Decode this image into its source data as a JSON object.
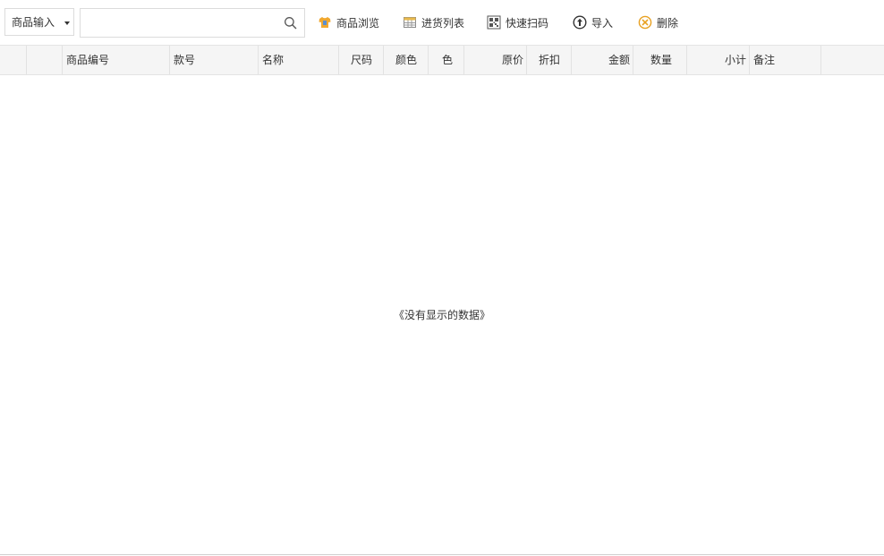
{
  "toolbar": {
    "mode_select": {
      "value": "商品输入"
    },
    "search": {
      "value": "",
      "placeholder": ""
    },
    "buttons": [
      {
        "label": "商品浏览",
        "icon": "shirt-icon"
      },
      {
        "label": "进货列表",
        "icon": "table-icon"
      },
      {
        "label": "快速扫码",
        "icon": "qr-code-icon"
      },
      {
        "label": "导入",
        "icon": "upload-icon"
      },
      {
        "label": "删除",
        "icon": "delete-circle-icon"
      }
    ]
  },
  "grid": {
    "columns": [
      "",
      "",
      "商品编号",
      "款号",
      "名称",
      "尺码",
      "颜色",
      "色",
      "原价",
      "折扣",
      "金额",
      "数量",
      "小计",
      "备注",
      ""
    ],
    "rows": [],
    "empty_text": "《没有显示的数据》"
  },
  "colors": {
    "header_bg": "#f5f5f5",
    "border": "#e2e2e2",
    "shirt_icon": "#f0a830",
    "delete_icon": "#e8a020"
  }
}
